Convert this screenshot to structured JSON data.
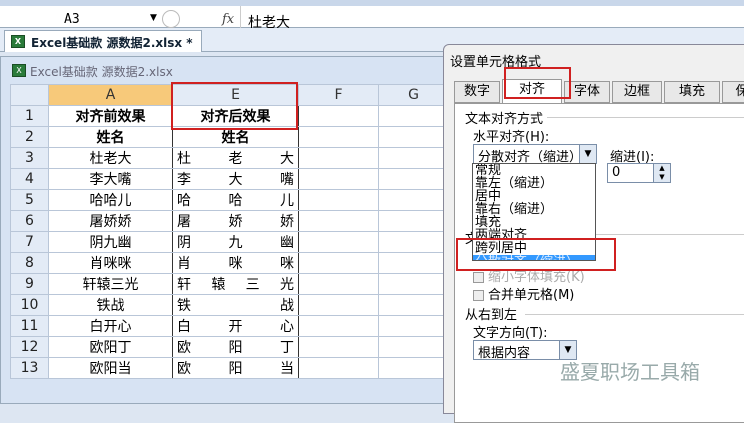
{
  "formula_bar": {
    "name_box": "A3",
    "fx": "fx",
    "value": "杜老大"
  },
  "doc_tab": "Excel基础款 源数据2.xlsx *",
  "window_title": "Excel基础款 源数据2.xlsx",
  "columns": [
    "A",
    "E",
    "F",
    "G"
  ],
  "rows": [
    {
      "n": "1",
      "a": "对齐前效果",
      "e": "对齐后效果"
    },
    {
      "n": "2",
      "a": "姓名",
      "e": "姓名"
    },
    {
      "n": "3",
      "a": "杜老大",
      "e": "杜老大"
    },
    {
      "n": "4",
      "a": "李大嘴",
      "e": "李大嘴"
    },
    {
      "n": "5",
      "a": "哈哈儿",
      "e": "哈哈儿"
    },
    {
      "n": "6",
      "a": "屠娇娇",
      "e": "屠娇娇"
    },
    {
      "n": "7",
      "a": "阴九幽",
      "e": "阴九幽"
    },
    {
      "n": "8",
      "a": "肖咪咪",
      "e": "肖咪咪"
    },
    {
      "n": "9",
      "a": "轩辕三光",
      "e": "轩辕三光"
    },
    {
      "n": "10",
      "a": "铁战",
      "e": "铁战"
    },
    {
      "n": "11",
      "a": "白开心",
      "e": "白开心"
    },
    {
      "n": "12",
      "a": "欧阳丁",
      "e": "欧阳丁"
    },
    {
      "n": "13",
      "a": "欧阳当",
      "e": "欧阳当"
    }
  ],
  "dialog": {
    "title": "设置单元格格式",
    "tabs": [
      "数字",
      "对齐",
      "字体",
      "边框",
      "填充",
      "保"
    ],
    "group_text_align": "文本对齐方式",
    "horizontal_label": "水平对齐(H):",
    "horizontal_value": "分散对齐（缩进）",
    "indent_label": "缩进(I):",
    "indent_value": "0",
    "options": [
      "常规",
      "靠左（缩进）",
      "居中",
      "靠右（缩进）",
      "填充",
      "两端对齐",
      "跨列居中",
      "分散对齐（缩进）"
    ],
    "group_text_control_partial": "文",
    "shrink_label": "缩小字体填充(K)",
    "merge_label": "合并单元格(M)",
    "group_rtl": "从右到左",
    "direction_label": "文字方向(T):",
    "direction_value": "根据内容"
  },
  "watermark": "盛夏职场工具箱"
}
